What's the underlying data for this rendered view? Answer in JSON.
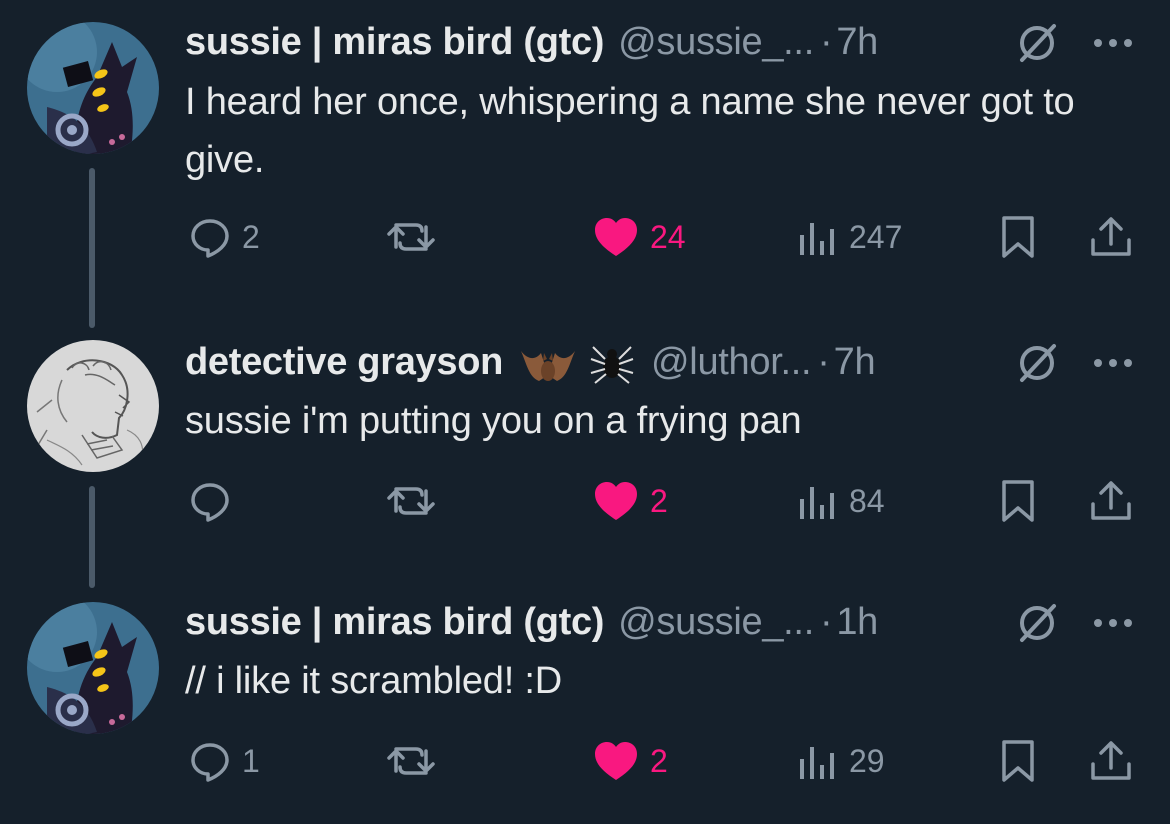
{
  "colors": {
    "background": "#15202b",
    "text": "#e7e9ea",
    "muted": "#8b98a5",
    "like": "#f91880",
    "thread_line": "#4b5a69"
  },
  "tweets": [
    {
      "name": "sussie | miras bird (gtc)",
      "handle": "@sussie_...",
      "dot": "·",
      "time": "7h",
      "emoji": "",
      "text": "I heard her once, whispering a name she never got to give.",
      "replies": "2",
      "retweets": "",
      "likes": "24",
      "liked": true,
      "views": "247",
      "avatar": "bird-character-avatar",
      "icons": [
        "reply-icon",
        "retweet-icon",
        "heart-icon",
        "views-icon",
        "bookmark-icon",
        "share-icon",
        "grok-icon",
        "more-icon"
      ]
    },
    {
      "name": "detective grayson",
      "handle": "@luthor...",
      "dot": "·",
      "time": "7h",
      "emoji": "🦇 🕷",
      "text": "sussie i'm putting you on a frying pan",
      "replies": "",
      "retweets": "",
      "likes": "2",
      "liked": true,
      "views": "84",
      "avatar": "sketch-portrait-avatar",
      "icons": [
        "reply-icon",
        "retweet-icon",
        "heart-icon",
        "views-icon",
        "bookmark-icon",
        "share-icon",
        "grok-icon",
        "more-icon"
      ]
    },
    {
      "name": "sussie | miras bird (gtc)",
      "handle": "@sussie_...",
      "dot": "·",
      "time": "1h",
      "emoji": "",
      "text": "// i like it scrambled! :D",
      "replies": "1",
      "retweets": "",
      "likes": "2",
      "liked": true,
      "views": "29",
      "avatar": "bird-character-avatar",
      "icons": [
        "reply-icon",
        "retweet-icon",
        "heart-icon",
        "views-icon",
        "bookmark-icon",
        "share-icon",
        "grok-icon",
        "more-icon"
      ]
    }
  ]
}
